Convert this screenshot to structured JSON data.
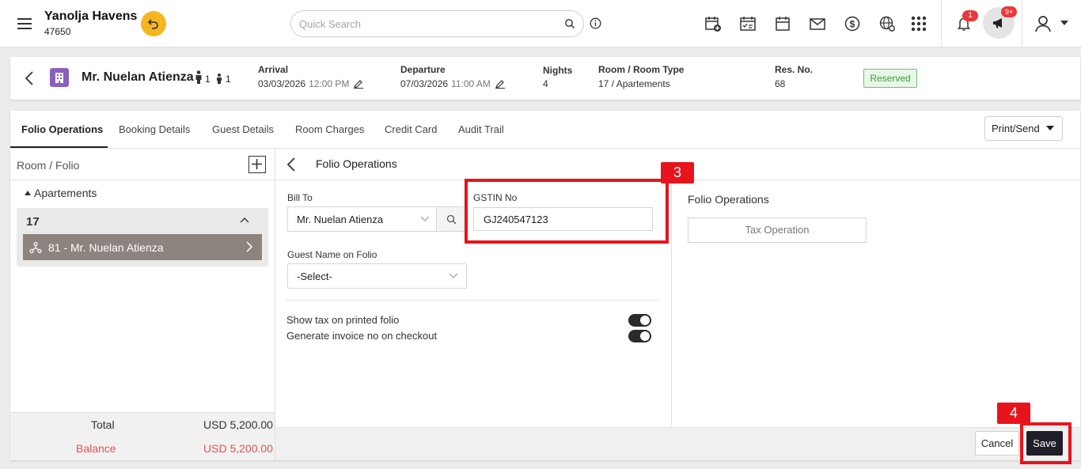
{
  "app": {
    "hotel_name": "Yanolja Havens",
    "hotel_code": "47650",
    "search_placeholder": "Quick Search",
    "notification_count": "1",
    "announcement_count": "9+"
  },
  "reservation": {
    "guest_name": "Mr. Nuelan Atienza",
    "adults": "1",
    "children": "1",
    "arrival_label": "Arrival",
    "arrival_date": "03/03/2026",
    "arrival_time": "12:00 PM",
    "departure_label": "Departure",
    "departure_date": "07/03/2026",
    "departure_time": "11:00 AM",
    "nights_label": "Nights",
    "nights": "4",
    "room_label": "Room / Room Type",
    "room_value": "17 / Apartements",
    "resno_label": "Res. No.",
    "resno": "68",
    "status": "Reserved",
    "status_color": "#3e9a3e"
  },
  "tabs": [
    {
      "label": "Folio Operations"
    },
    {
      "label": "Booking Details"
    },
    {
      "label": "Guest Details"
    },
    {
      "label": "Room Charges"
    },
    {
      "label": "Credit Card"
    },
    {
      "label": "Audit Trail"
    }
  ],
  "print_send": "Print/Send",
  "left_pane": {
    "title": "Room / Folio",
    "group": "Apartements",
    "room": "17",
    "folio": "81 - Mr. Nuelan Atienza",
    "total_label": "Total",
    "total_value": "USD 5,200.00",
    "balance_label": "Balance",
    "balance_value": "USD 5,200.00"
  },
  "center": {
    "title": "Folio Operations",
    "bill_to_label": "Bill To",
    "bill_to_value": "Mr. Nuelan Atienza",
    "gstin_label": "GSTIN No",
    "gstin_value": "GJ240547123",
    "guest_name_label": "Guest Name on Folio",
    "guest_name_value": "-Select-",
    "toggle1_label": "Show tax on printed folio",
    "toggle1_on": true,
    "toggle2_label": "Generate invoice no on checkout",
    "toggle2_on": true
  },
  "right": {
    "title": "Folio Operations",
    "tax_operation": "Tax Operation"
  },
  "footer": {
    "cancel": "Cancel",
    "save": "Save"
  },
  "annotations": {
    "step3": "3",
    "step4": "4",
    "color": "#e8141c"
  }
}
